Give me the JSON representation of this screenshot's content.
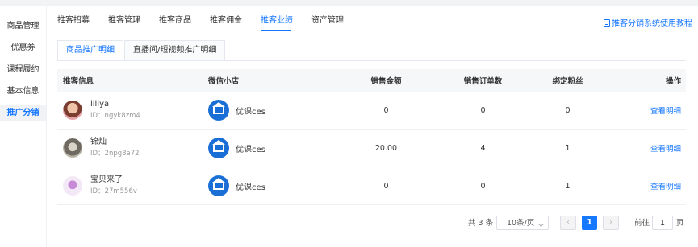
{
  "sidebar": {
    "items": [
      {
        "label": "商品管理",
        "active": false
      },
      {
        "label": "优惠券",
        "active": false
      },
      {
        "label": "课程履约",
        "active": false
      },
      {
        "label": "基本信息",
        "active": false
      },
      {
        "label": "推广分销",
        "active": true
      }
    ]
  },
  "tabs": [
    {
      "label": "推客招募"
    },
    {
      "label": "推客管理"
    },
    {
      "label": "推客商品"
    },
    {
      "label": "推客佣金"
    },
    {
      "label": "推客业绩",
      "active": true
    },
    {
      "label": "资产管理"
    }
  ],
  "help_link": "推客分销系统使用教程",
  "subtabs": [
    {
      "label": "商品推广明细",
      "active": true
    },
    {
      "label": "直播间/短视频推广明细"
    }
  ],
  "table": {
    "headers": {
      "promoter": "推客信息",
      "shop": "微信小店",
      "sales_amount": "销售金额",
      "order_count": "销售订单数",
      "bound_fans": "绑定粉丝",
      "actions": "操作"
    },
    "rows": [
      {
        "name": "liliya",
        "id": "ID：ngyk8zm4",
        "shop": "优课ces",
        "sales_amount": "0",
        "order_count": "0",
        "bound_fans": "0",
        "action": "查看明细"
      },
      {
        "name": "锦灿",
        "id": "ID：2npg8a72",
        "shop": "优课ces",
        "sales_amount": "20.00",
        "order_count": "4",
        "bound_fans": "1",
        "action": "查看明细"
      },
      {
        "name": "宝贝来了",
        "id": "ID：27m556v",
        "shop": "优课ces",
        "sales_amount": "0",
        "order_count": "0",
        "bound_fans": "1",
        "action": "查看明细"
      }
    ]
  },
  "pagination": {
    "total_text": "共 3 条",
    "page_size": "10条/页",
    "current_page": "1",
    "goto_label": "前往",
    "goto_value": "1",
    "page_suffix": "页"
  },
  "colors": {
    "accent": "#1677ff",
    "shop_logo": "#1a6fd6"
  }
}
